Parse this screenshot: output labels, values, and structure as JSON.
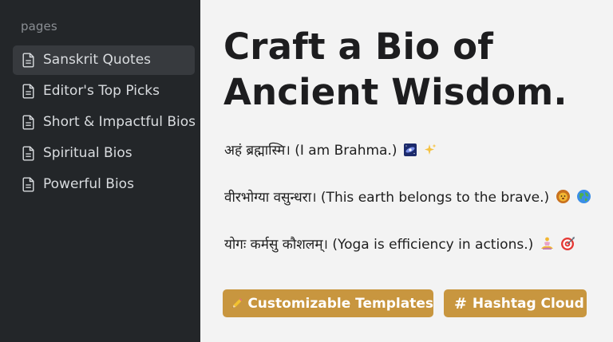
{
  "sidebar": {
    "heading": "pages",
    "items": [
      {
        "label": "Sanskrit Quotes",
        "icon": "document-icon",
        "active": true
      },
      {
        "label": "Editor's Top Picks",
        "icon": "document-icon",
        "active": false
      },
      {
        "label": "Short & Impactful Bios",
        "icon": "document-icon",
        "active": false
      },
      {
        "label": "Spiritual Bios",
        "icon": "document-icon",
        "active": false
      },
      {
        "label": "Powerful Bios",
        "icon": "document-icon",
        "active": false
      }
    ]
  },
  "main": {
    "title": "Craft a Bio of Ancient Wisdom.",
    "quotes": [
      {
        "sanskrit": "अहं ब्रह्मास्मि।",
        "translation": "(I am Brahma.)",
        "emojis": [
          "galaxy-icon",
          "sparkles-icon"
        ]
      },
      {
        "sanskrit": "वीरभोग्या वसुन्धरा।",
        "translation": "(This earth belongs to the brave.)",
        "emojis": [
          "lion-icon",
          "globe-icon"
        ]
      },
      {
        "sanskrit": "योगः कर्मसु कौशलम्।",
        "translation": "(Yoga is efficiency in actions.)",
        "emojis": [
          "meditation-icon",
          "target-icon"
        ]
      }
    ],
    "buttons": [
      {
        "label": "Customizable Templates",
        "icon": "pencil-icon"
      },
      {
        "label": "Hashtag Cloud",
        "icon": "hash-icon"
      }
    ]
  },
  "colors": {
    "sidebar_bg": "#232629",
    "sidebar_active_bg": "#373a3e",
    "main_bg": "#f3f3f3",
    "button_bg": "#c8963f",
    "title_text": "#1d1d1f"
  }
}
